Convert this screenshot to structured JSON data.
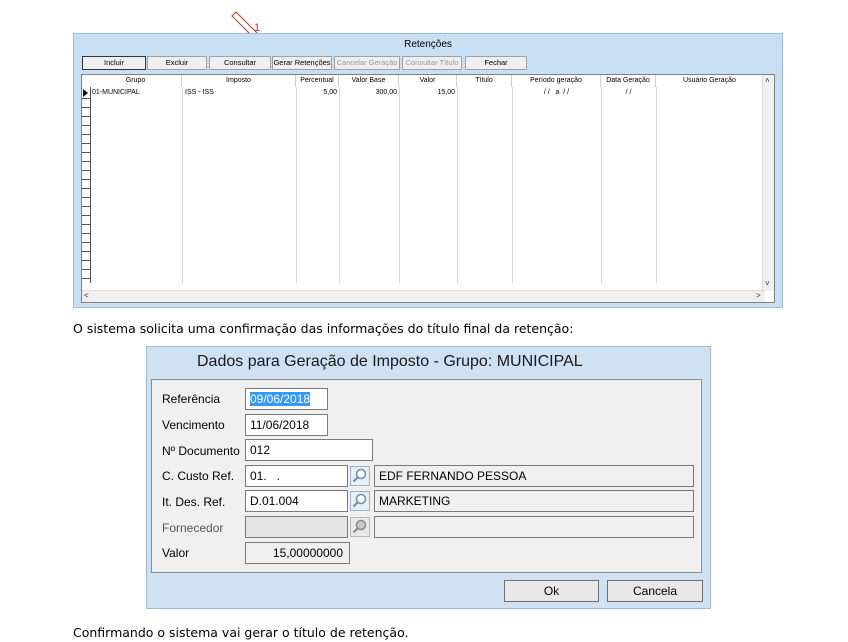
{
  "annotation": {
    "number": "1"
  },
  "retencoes": {
    "title": "Retenções",
    "toolbar": {
      "incluir": "Incluir",
      "excluir": "Excluir",
      "consultar": "Consultar",
      "gerar": "Gerar Retenções",
      "cancelar": "Cancelar Geração",
      "consultar_titulo": "Consultar Título",
      "fechar": "Fechar"
    },
    "columns": [
      "Grupo",
      "Imposto",
      "Percentual",
      "Valor Base",
      "Valor",
      "Título",
      "Período geração",
      "Data Geração",
      "Usuário Geração"
    ],
    "row": {
      "grupo": "01-MUNICIPAL",
      "imposto": "ISS - ISS",
      "percentual": "5,00",
      "valor_base": "300,00",
      "valor": "15,00",
      "titulo": "",
      "periodo": "/ /   a  / /",
      "data": "/ /",
      "usuario": ""
    }
  },
  "text1": "O sistema solicita uma confirmação das informações do título final da retenção:",
  "dialog": {
    "title": "Dados para Geração de Imposto - Grupo: MUNICIPAL",
    "labels": {
      "referencia": "Referência",
      "vencimento": "Vencimento",
      "documento": "Nº Documento",
      "custo": "C. Custo Ref.",
      "itdes": "It. Des. Ref.",
      "fornecedor": "Fornecedor",
      "valor": "Valor"
    },
    "values": {
      "referencia": "09/06/2018",
      "vencimento": "11/06/2018",
      "documento": "012",
      "custo_code": "01.   .",
      "custo_desc": "EDF FERNANDO PESSOA",
      "itdes_code": "D.01.004",
      "itdes_desc": "MARKETING",
      "fornecedor_code": "",
      "fornecedor_desc": "",
      "valor": "15,00000000"
    },
    "buttons": {
      "ok": "Ok",
      "cancela": "Cancela"
    }
  },
  "text2": "Confirmando o sistema vai gerar o título de retenção."
}
